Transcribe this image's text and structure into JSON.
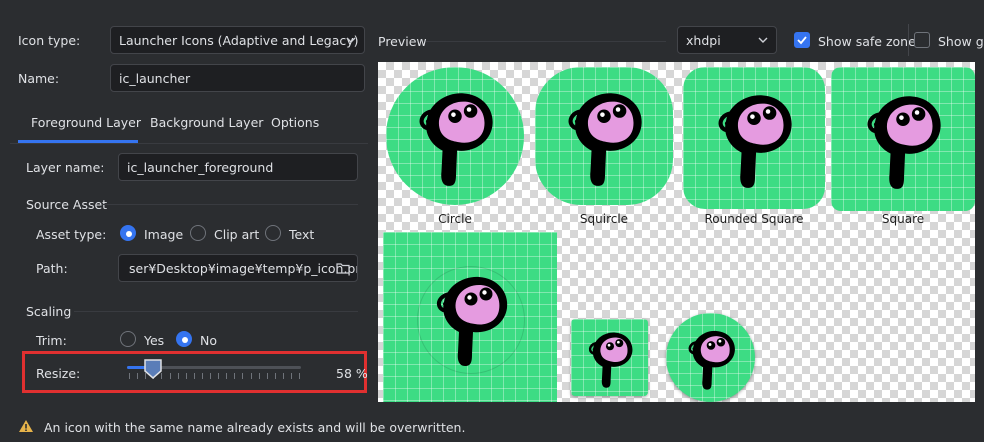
{
  "form": {
    "icon_type_label": "Icon type:",
    "icon_type_value": "Launcher Icons (Adaptive and Legacy)",
    "name_label": "Name:",
    "name_value": "ic_launcher"
  },
  "tabs": [
    "Foreground Layer",
    "Background Layer",
    "Options"
  ],
  "foreground": {
    "layer_name_label": "Layer name:",
    "layer_name_value": "ic_launcher_foreground",
    "source_asset_heading": "Source Asset",
    "asset_type_label": "Asset type:",
    "asset_type_options": [
      "Image",
      "Clip art",
      "Text"
    ],
    "asset_type_selected": "Image",
    "path_label": "Path:",
    "path_value": "ser¥Desktop¥image¥temp¥p_icon.png",
    "scaling_heading": "Scaling",
    "trim_label": "Trim:",
    "trim_options": [
      "Yes",
      "No"
    ],
    "trim_selected": "No",
    "resize_label": "Resize:",
    "resize_value": "58 %",
    "resize_percent": 58
  },
  "preview": {
    "label": "Preview",
    "density_value": "xhdpi",
    "show_safe_zone_label": "Show safe zone",
    "show_safe_zone_checked": true,
    "show_grid_label": "Show grid",
    "show_grid_checked": false,
    "shape_captions": [
      "Circle",
      "Squircle",
      "Rounded Square",
      "Square"
    ]
  },
  "warning": {
    "icon": "warning-icon",
    "text": "An icon with the same name already exists and will be overwritten."
  },
  "colors": {
    "icon_background": "#3ddc84",
    "logo_pink": "#e59be0",
    "highlight_border": "#e03030",
    "accent": "#3574f0"
  }
}
